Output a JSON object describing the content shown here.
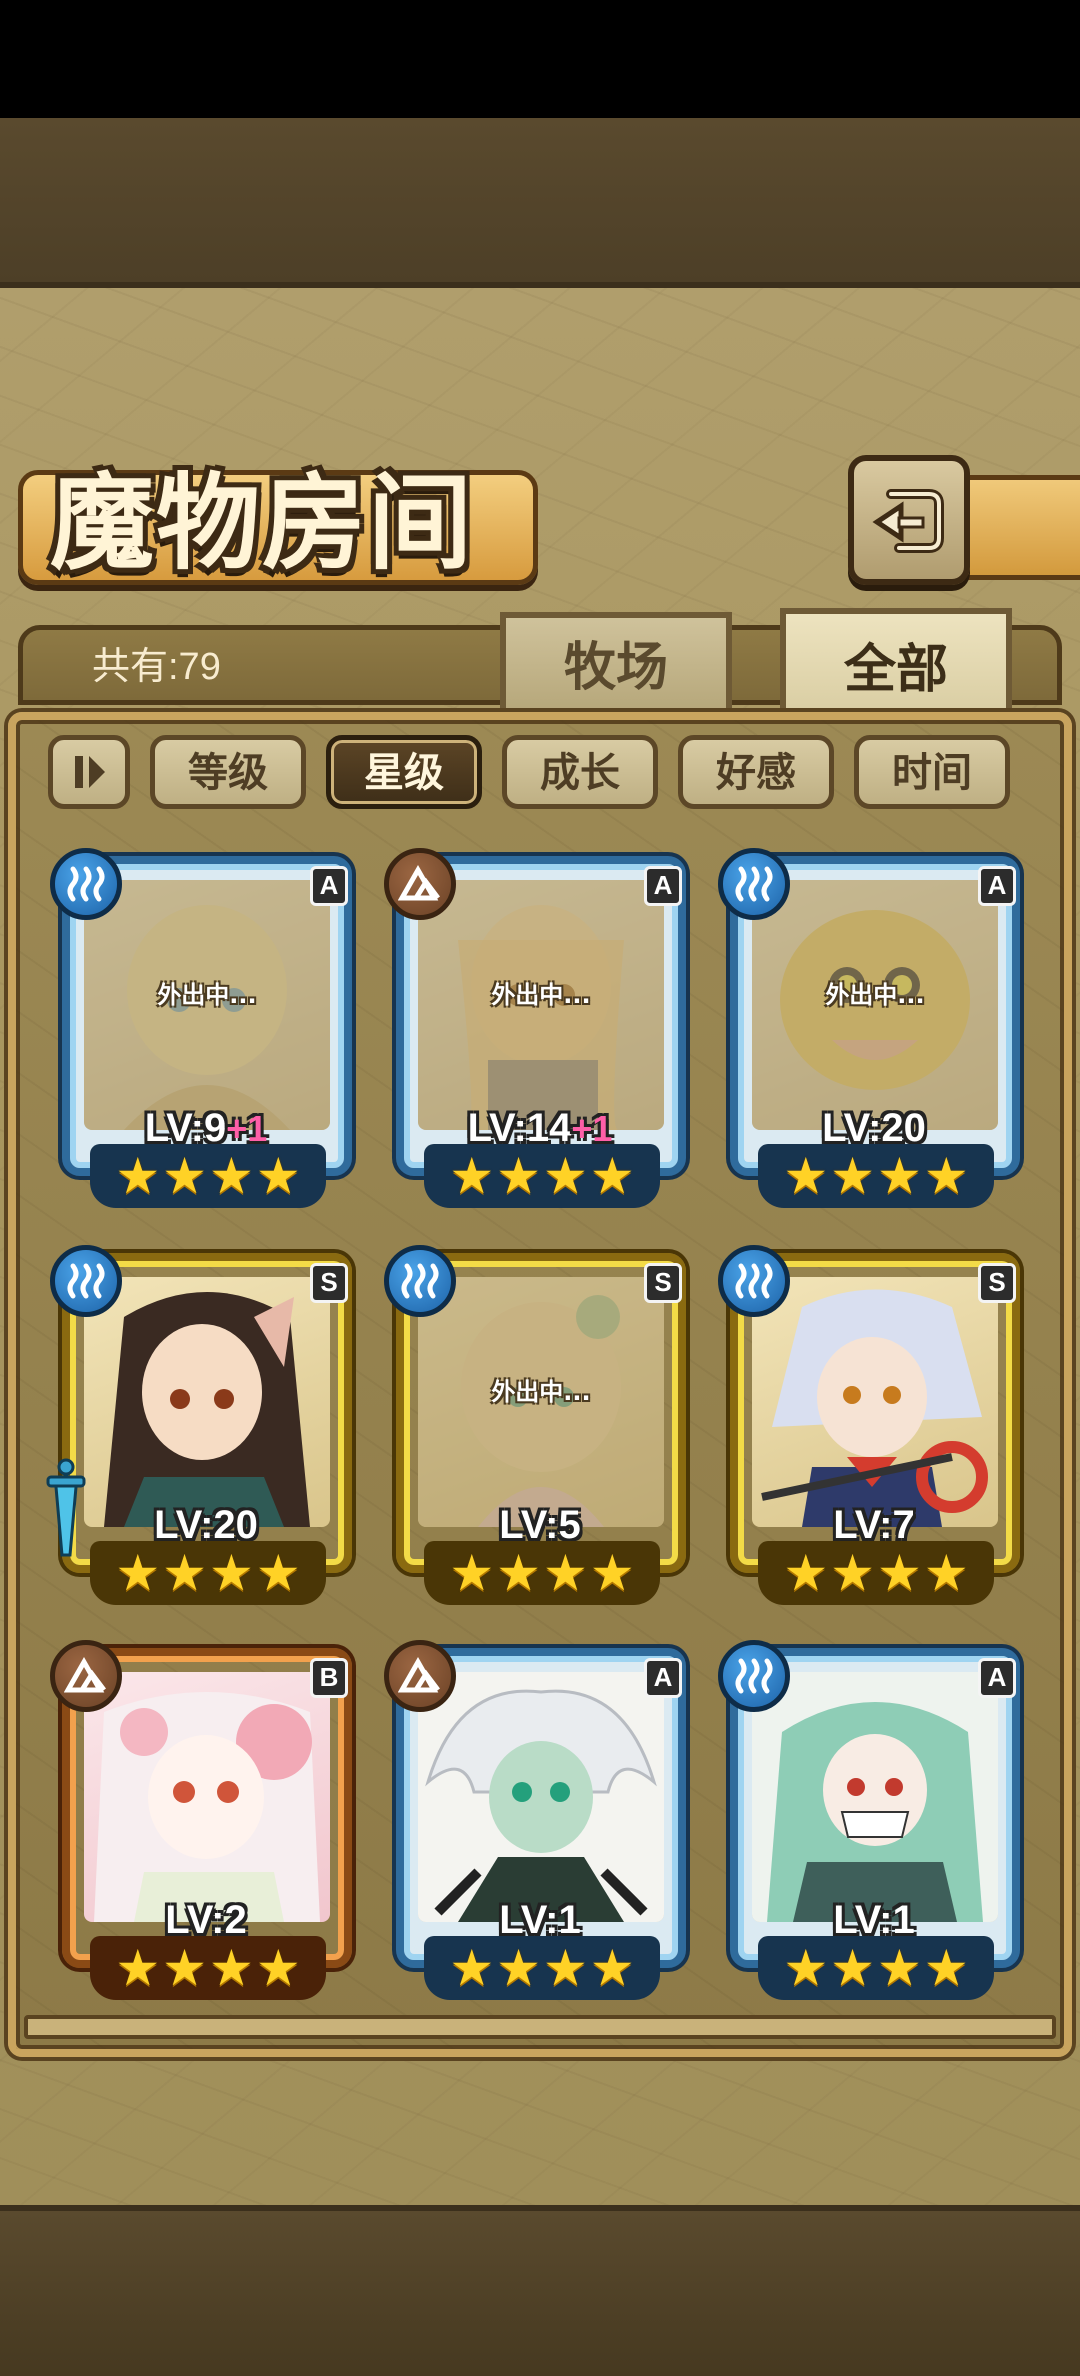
{
  "header": {
    "title": "魔物房间"
  },
  "tabs": {
    "ranch": "牧场",
    "all": "全部"
  },
  "count": {
    "label": "共有:79"
  },
  "sort": [
    "等级",
    "星级",
    "成长",
    "好感",
    "时间"
  ],
  "away_text": "外出中...",
  "colors": {
    "water": "#2e82d2",
    "earth": "#7a4a2a",
    "gold_frame": "#f3db47",
    "blue_frame": "#9fd4f1",
    "orange_frame": "#f2a14d",
    "star": "#ffd226",
    "bonus": "#ff5fa8"
  },
  "monsters": [
    {
      "element": "water-icon",
      "rank": "A",
      "level": "LV:9",
      "bonus": "+1",
      "stars": 4,
      "away": true,
      "frame": "blue"
    },
    {
      "element": "earth-icon",
      "rank": "A",
      "level": "LV:14",
      "bonus": "+1",
      "stars": 4,
      "away": true,
      "frame": "blue"
    },
    {
      "element": "water-icon",
      "rank": "A",
      "level": "LV:20",
      "bonus": "",
      "stars": 4,
      "away": true,
      "frame": "blue"
    },
    {
      "element": "water-icon",
      "rank": "S",
      "level": "LV:20",
      "bonus": "",
      "stars": 4,
      "away": false,
      "frame": "gold",
      "weapon": "sword-icon"
    },
    {
      "element": "water-icon",
      "rank": "S",
      "level": "LV:5",
      "bonus": "",
      "stars": 4,
      "away": true,
      "frame": "gold"
    },
    {
      "element": "water-icon",
      "rank": "S",
      "level": "LV:7",
      "bonus": "",
      "stars": 4,
      "away": false,
      "frame": "gold"
    },
    {
      "element": "earth-icon",
      "rank": "B",
      "level": "LV:2",
      "bonus": "",
      "stars": 4,
      "away": false,
      "frame": "orange"
    },
    {
      "element": "earth-icon",
      "rank": "A",
      "level": "LV:1",
      "bonus": "",
      "stars": 4,
      "away": false,
      "frame": "blue"
    },
    {
      "element": "water-icon",
      "rank": "A",
      "level": "LV:1",
      "bonus": "",
      "stars": 4,
      "away": false,
      "frame": "blue"
    }
  ]
}
